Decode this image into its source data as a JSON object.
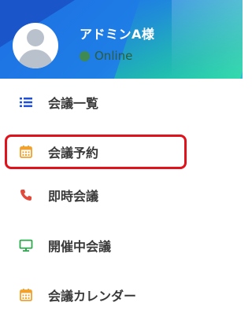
{
  "profile": {
    "username": "アドミンA様",
    "status": "Online",
    "status_color": "#3f8a52",
    "avatar_icon": "user-avatar-icon"
  },
  "menu": {
    "items": [
      {
        "label": "会議一覧",
        "icon": "list-icon",
        "icon_color": "#1f4fd8"
      },
      {
        "label": "会議予約",
        "icon": "calendar-icon",
        "icon_color": "#f2a12b",
        "highlighted": true
      },
      {
        "label": "即時会議",
        "icon": "phone-icon",
        "icon_color": "#e24a3b"
      },
      {
        "label": "開催中会議",
        "icon": "monitor-icon",
        "icon_color": "#2fa84f"
      },
      {
        "label": "会議カレンダー",
        "icon": "calendar-icon",
        "icon_color": "#f2a12b"
      }
    ]
  },
  "highlight_color": "#e0121b"
}
